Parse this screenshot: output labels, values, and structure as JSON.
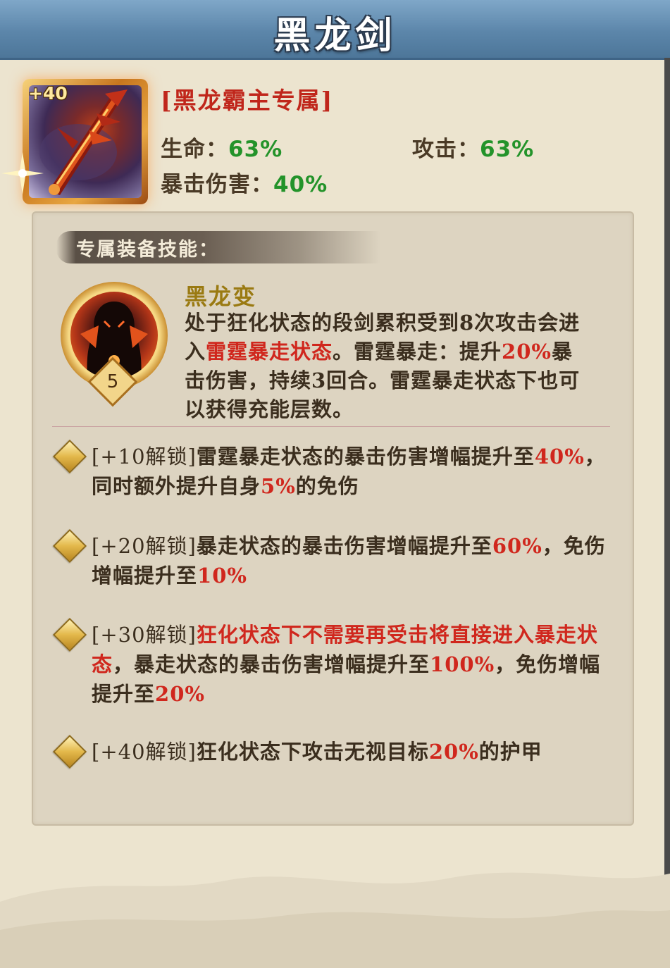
{
  "header": {
    "title": "黑龙剑"
  },
  "item": {
    "enhance_level": "+40",
    "exclusive_label": "[黑龙霸主专属]",
    "stats": {
      "hp_label": "生命：",
      "hp_value": "63%",
      "atk_label": "攻击：",
      "atk_value": "63%",
      "crit_label": "暴击伤害：",
      "crit_value": "40%"
    }
  },
  "skill_section": {
    "heading": "专属装备技能：",
    "skill": {
      "name": "黑龙变",
      "level": "5",
      "desc_parts": [
        "处于狂化状态的段剑累积受到8次攻击会进入",
        "雷霆暴走状态",
        "。雷霆暴走：提升",
        "20%",
        "暴击伤害，持续3回合。雷霆暴走状态下也可以获得充能层数。"
      ]
    }
  },
  "unlocks": [
    {
      "tag": "[+10解锁]",
      "parts": [
        "雷霆暴走状态的暴击伤害增幅提升至",
        "40%",
        "，同时额外提升自身",
        "5%",
        "的免伤"
      ]
    },
    {
      "tag": "[+20解锁]",
      "parts": [
        "暴走状态的暴击伤害增幅提升至",
        "60%",
        "，免伤增幅提升至",
        "10%",
        ""
      ]
    },
    {
      "tag": "[+30解锁]",
      "parts": [
        "",
        "狂化状态下不需要再受击将直接进入暴走状态",
        "，暴走状态的暴击伤害增幅提升至",
        "100%",
        "，免伤增幅提升至",
        "20%",
        ""
      ]
    },
    {
      "tag": "[+40解锁]",
      "parts": [
        "狂化状态下攻击无视目标",
        "20%",
        "的护甲"
      ]
    }
  ],
  "colors": {
    "highlight_red": "#d0271d",
    "stat_green": "#23932a",
    "skill_name_gold": "#9a7a12",
    "header_blue": "#5c86aa"
  },
  "icons": [
    "black-dragon-sword-icon",
    "sparkle-icon",
    "black-dragon-skill-icon",
    "diamond-bullet-icon"
  ]
}
